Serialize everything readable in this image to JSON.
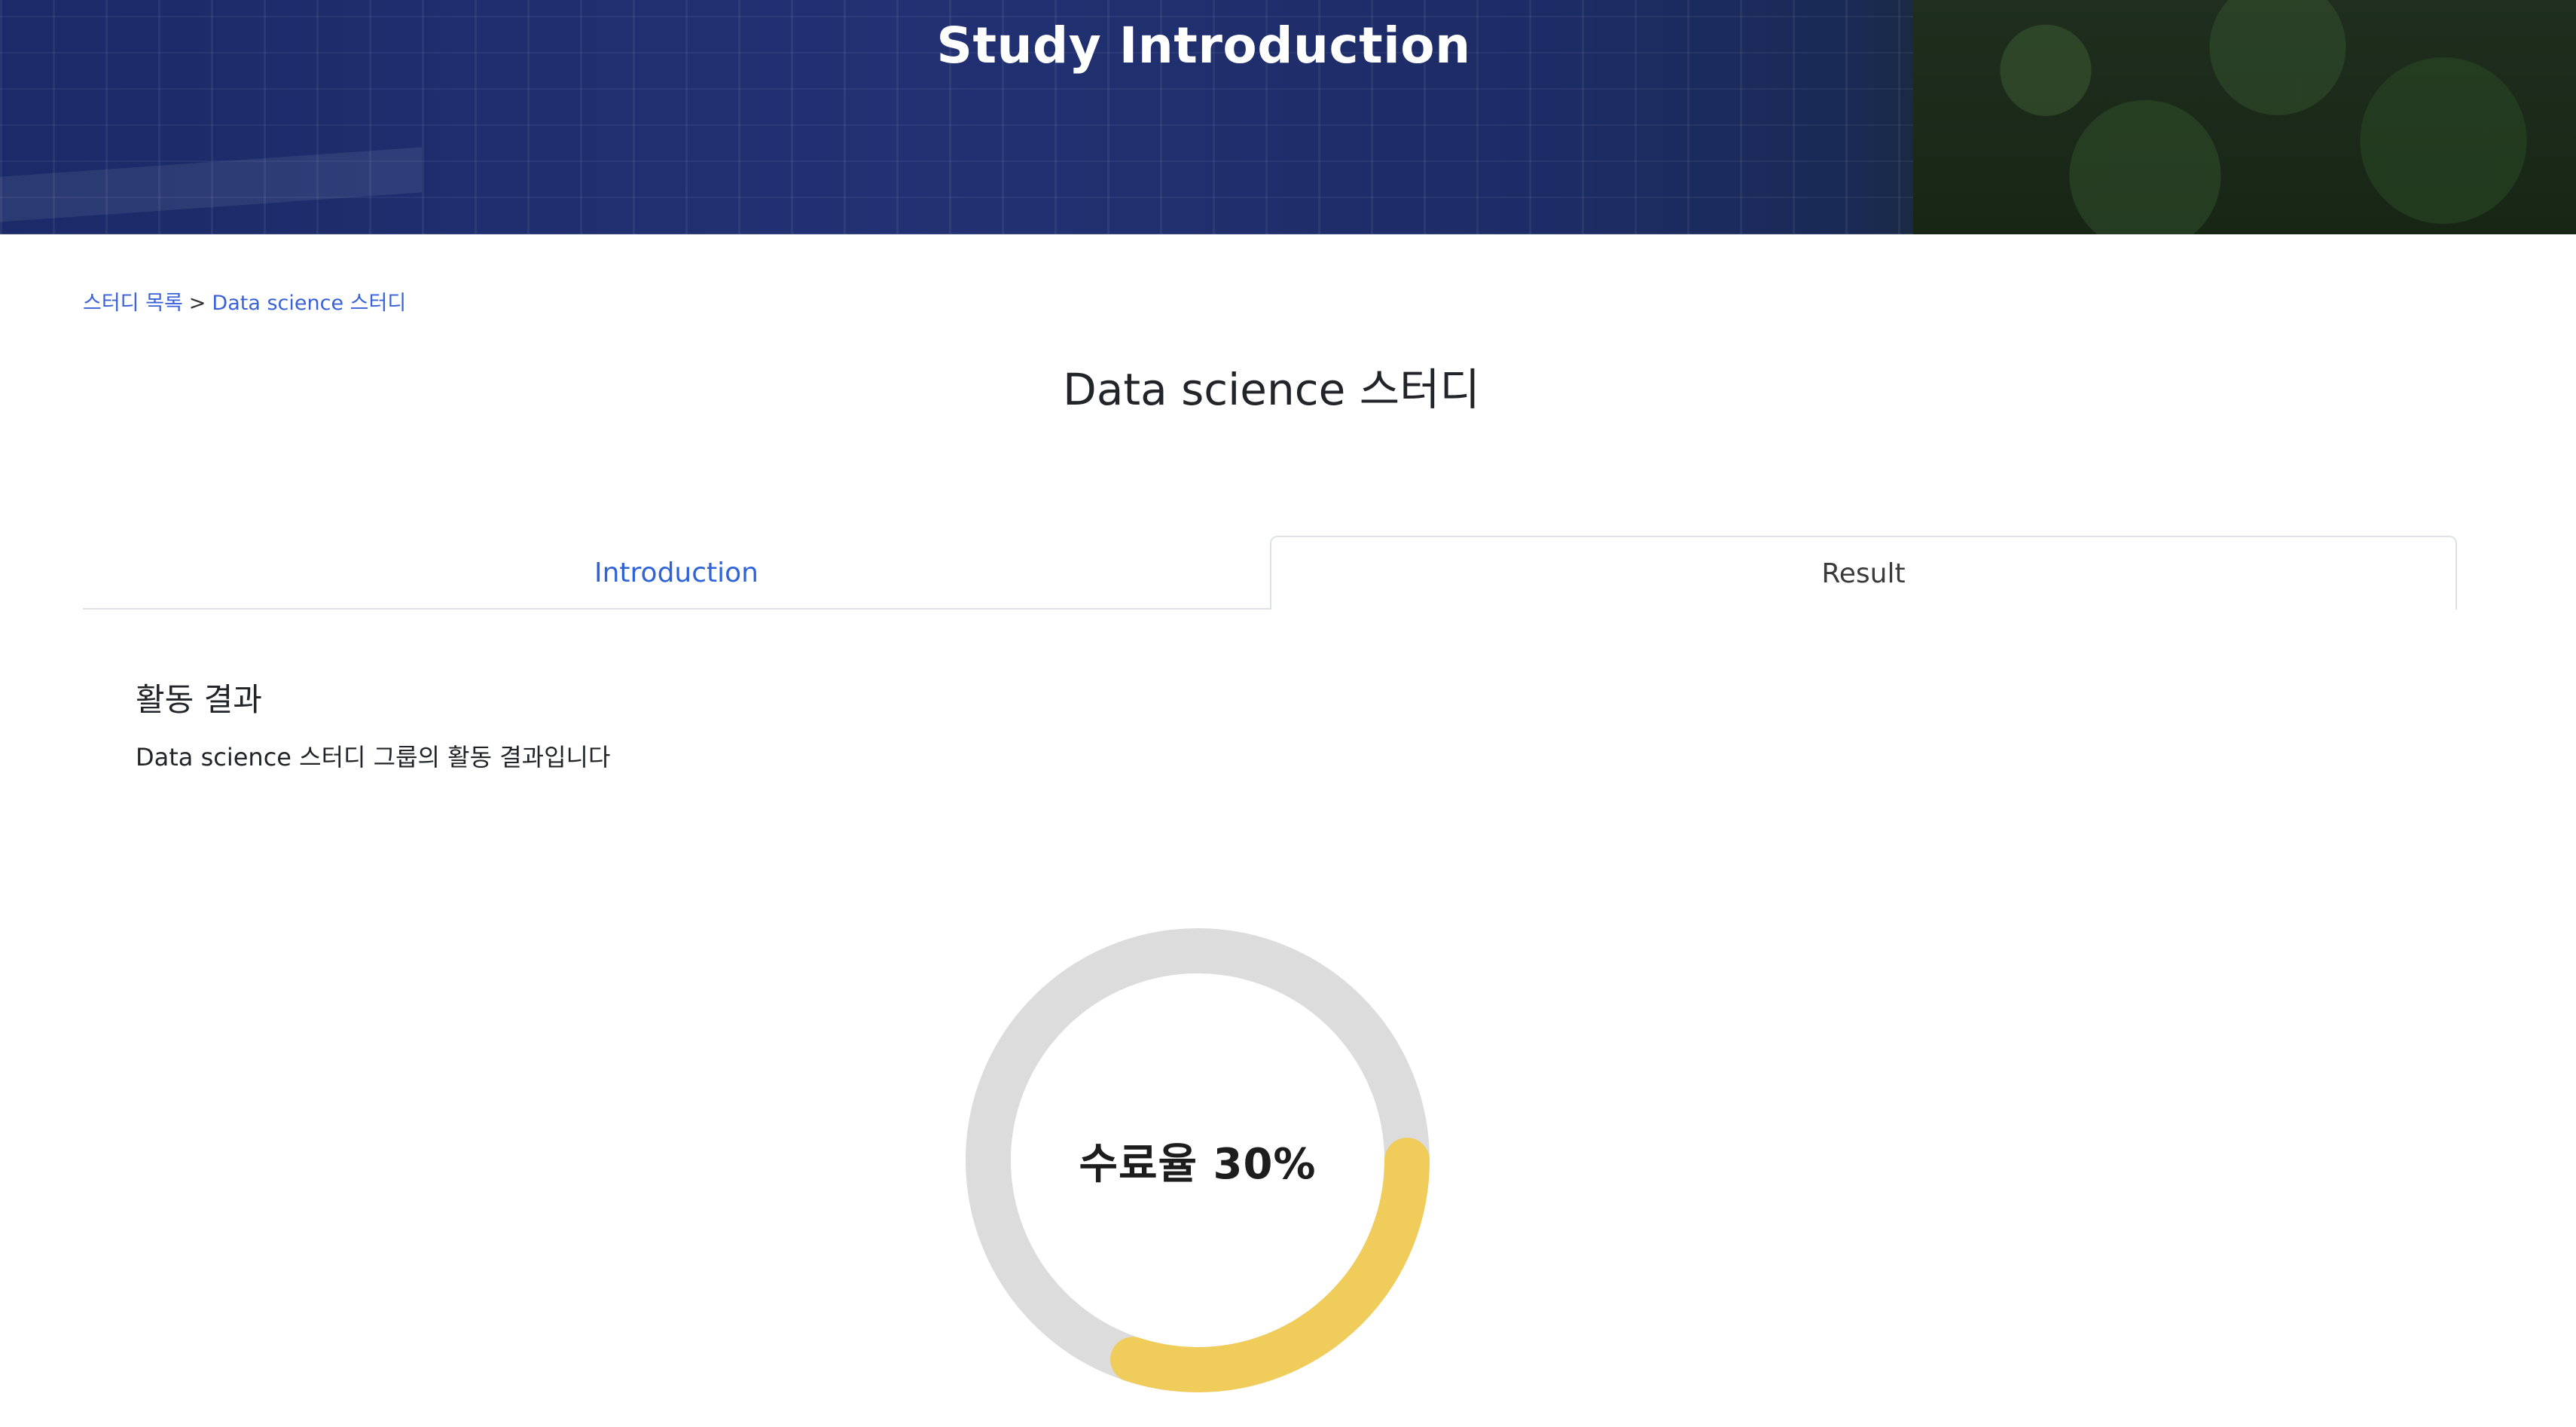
{
  "hero": {
    "title": "Study Introduction"
  },
  "breadcrumb": {
    "parent": "스터디 목록",
    "separator": ">",
    "current": "Data science 스터디"
  },
  "page_title": "Data science 스터디",
  "tabs": [
    {
      "label": "Introduction",
      "color": "#2f64d8"
    },
    {
      "label": "Result",
      "active": true
    }
  ],
  "result": {
    "heading": "활동 결과",
    "description": "Data science 스터디 그룹의 활동 결과입니다"
  },
  "completion": {
    "label": "수료율 30%",
    "fraction": 0.3,
    "fill_color": "#f0cc5a",
    "track_color": "#dcdcdc"
  }
}
